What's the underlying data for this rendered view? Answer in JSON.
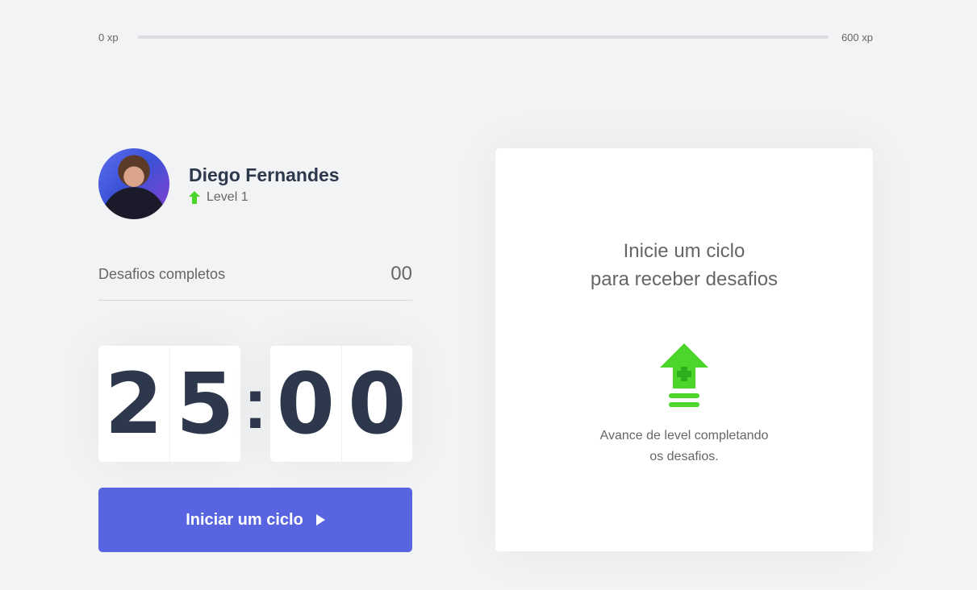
{
  "experience": {
    "min_label": "0 xp",
    "max_label": "600 xp",
    "progress_percent": 0
  },
  "profile": {
    "name": "Diego Fernandes",
    "level_label": "Level 1",
    "avatar_icon": "user-avatar-photo"
  },
  "challenges": {
    "label": "Desafios completos",
    "count": "00"
  },
  "countdown": {
    "minute_left": "2",
    "minute_right": "5",
    "separator": ":",
    "second_left": "0",
    "second_right": "0"
  },
  "start_button": {
    "label": "Iniciar um ciclo",
    "icon": "play-icon"
  },
  "challenge_box": {
    "title_line1": "Inicie um ciclo",
    "title_line2": "para receber desafios",
    "icon": "level-up-icon",
    "text_line1": "Avance de level completando",
    "text_line2": "os desafios."
  },
  "colors": {
    "background": "#f2f3f5",
    "primary": "#5965e0",
    "green": "#4cd62b",
    "title": "#2e384d",
    "text": "#666666"
  }
}
